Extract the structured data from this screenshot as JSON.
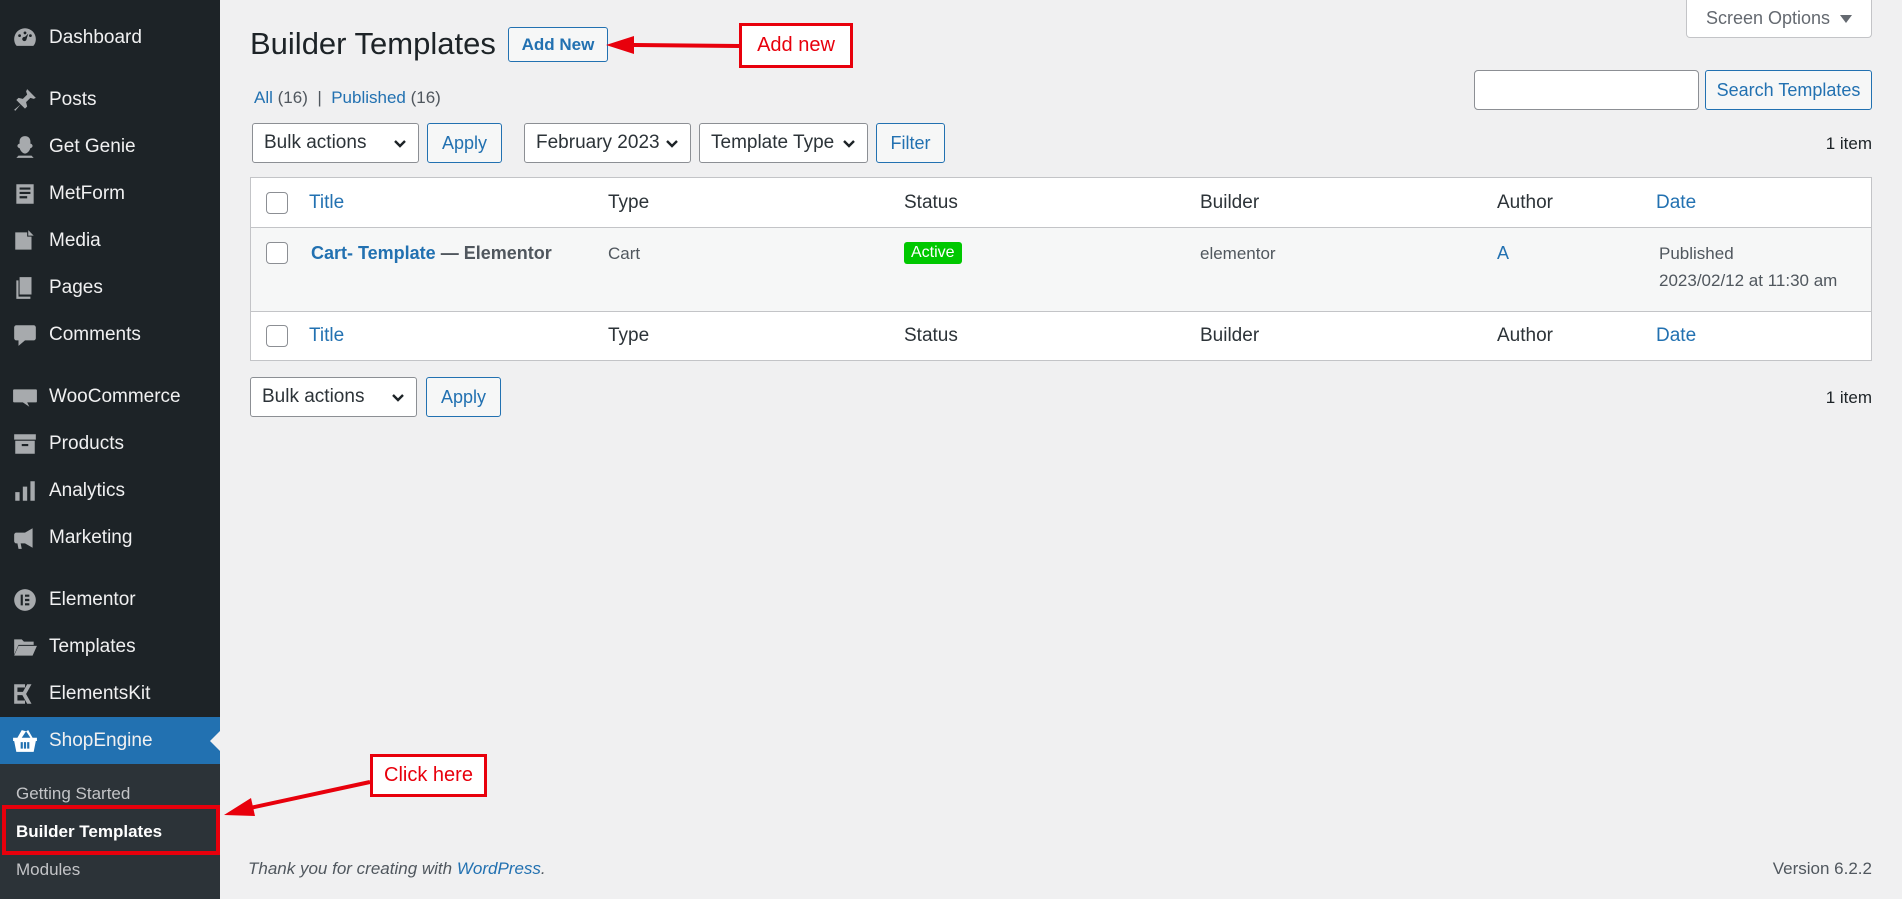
{
  "sidebar": {
    "items": [
      {
        "label": "Dashboard",
        "icon": "dashboard-icon"
      },
      {
        "label": "Posts",
        "icon": "pin-icon"
      },
      {
        "label": "Get Genie",
        "icon": "genie-icon"
      },
      {
        "label": "MetForm",
        "icon": "form-icon"
      },
      {
        "label": "Media",
        "icon": "media-icon"
      },
      {
        "label": "Pages",
        "icon": "pages-icon"
      },
      {
        "label": "Comments",
        "icon": "comment-icon"
      },
      {
        "label": "WooCommerce",
        "icon": "woo-icon"
      },
      {
        "label": "Products",
        "icon": "archive-icon"
      },
      {
        "label": "Analytics",
        "icon": "bar-chart-icon"
      },
      {
        "label": "Marketing",
        "icon": "megaphone-icon"
      },
      {
        "label": "Elementor",
        "icon": "elementor-icon"
      },
      {
        "label": "Templates",
        "icon": "folder-icon"
      },
      {
        "label": "ElementsKit",
        "icon": "elementskit-icon"
      },
      {
        "label": "ShopEngine",
        "icon": "basket-icon"
      }
    ],
    "submenu": [
      "Getting Started",
      "Builder Templates",
      "Modules"
    ]
  },
  "header": {
    "title": "Builder Templates",
    "add_new": "Add New",
    "screen_options": "Screen Options",
    "search_button": "Search Templates"
  },
  "filters": {
    "all_label": "All",
    "all_count": "(16)",
    "separator": "|",
    "published_label": "Published",
    "published_count": "(16)",
    "bulk_actions": "Bulk actions",
    "apply": "Apply",
    "date": "February 2023",
    "template_type": "Template Type",
    "filter": "Filter",
    "item_count": "1 item"
  },
  "table": {
    "columns": {
      "title": "Title",
      "type": "Type",
      "status": "Status",
      "builder": "Builder",
      "author": "Author",
      "date": "Date"
    },
    "row": {
      "title": "Cart- Template",
      "title_suffix": " — Elementor",
      "type": "Cart",
      "status": "Active",
      "builder": "elementor",
      "author": "A",
      "date_status": "Published",
      "date": "2023/02/12 at 11:30 am"
    }
  },
  "footer": {
    "thanks_prefix": "Thank you for creating with ",
    "wordpress": "WordPress",
    "thanks_suffix": ".",
    "version": "Version 6.2.2"
  },
  "annotations": {
    "add_new": "Add new",
    "click_here": "Click here",
    "color": "#e8000c"
  }
}
